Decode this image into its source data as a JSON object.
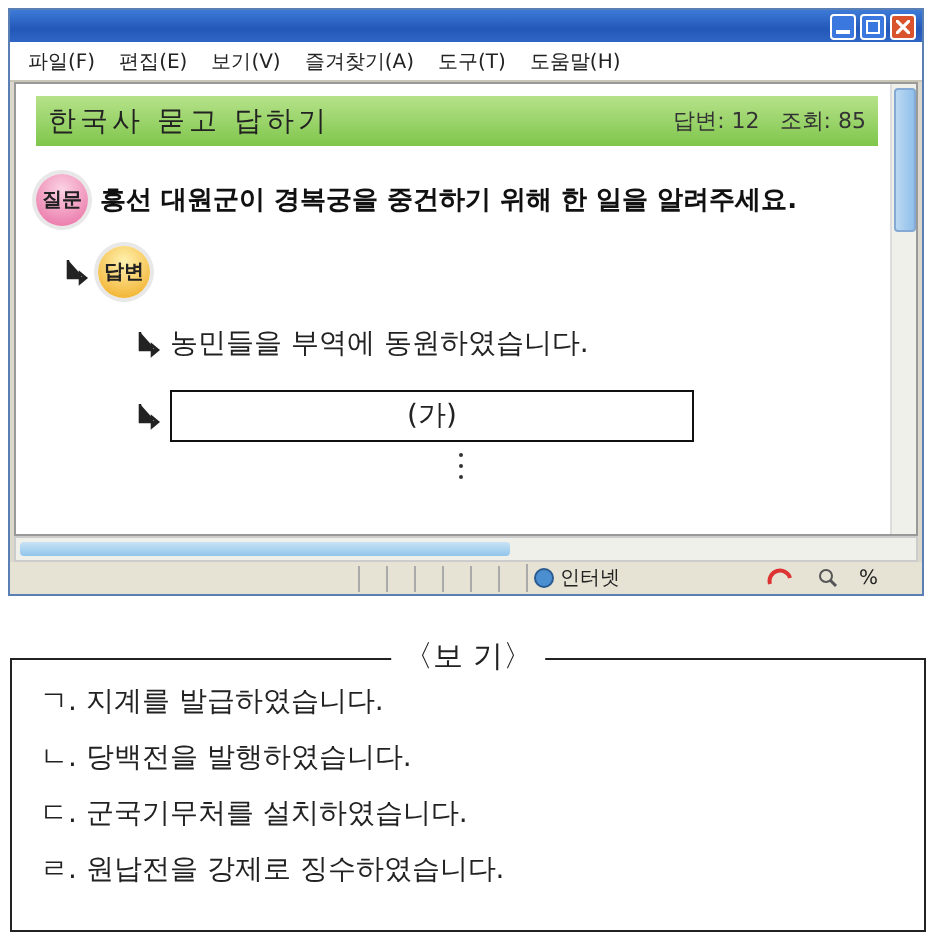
{
  "window": {
    "menu": [
      "파일(F)",
      "편집(E)",
      "보기(V)",
      "즐겨찾기(A)",
      "도구(T)",
      "도움말(H)"
    ]
  },
  "board": {
    "title": "한국사 묻고 답하기",
    "answers": "답변: 12",
    "views": "조회: 85"
  },
  "question": {
    "badge": "질문",
    "text": "흥선 대원군이 경복궁을 중건하기 위해 한 일을 알려주세요."
  },
  "answer": {
    "badge": "답변",
    "items": [
      {
        "kind": "text",
        "text": "농민들을 부역에 동원하였습니다."
      },
      {
        "kind": "blank",
        "text": "(가)"
      }
    ]
  },
  "status_bar": {
    "zone": "인터넷",
    "zoom": "%"
  },
  "choices": {
    "title": "〈보 기〉",
    "items": [
      "ㄱ. 지계를 발급하였습니다.",
      "ㄴ. 당백전을 발행하였습니다.",
      "ㄷ. 군국기무처를 설치하였습니다.",
      "ㄹ. 원납전을 강제로 징수하였습니다."
    ]
  }
}
